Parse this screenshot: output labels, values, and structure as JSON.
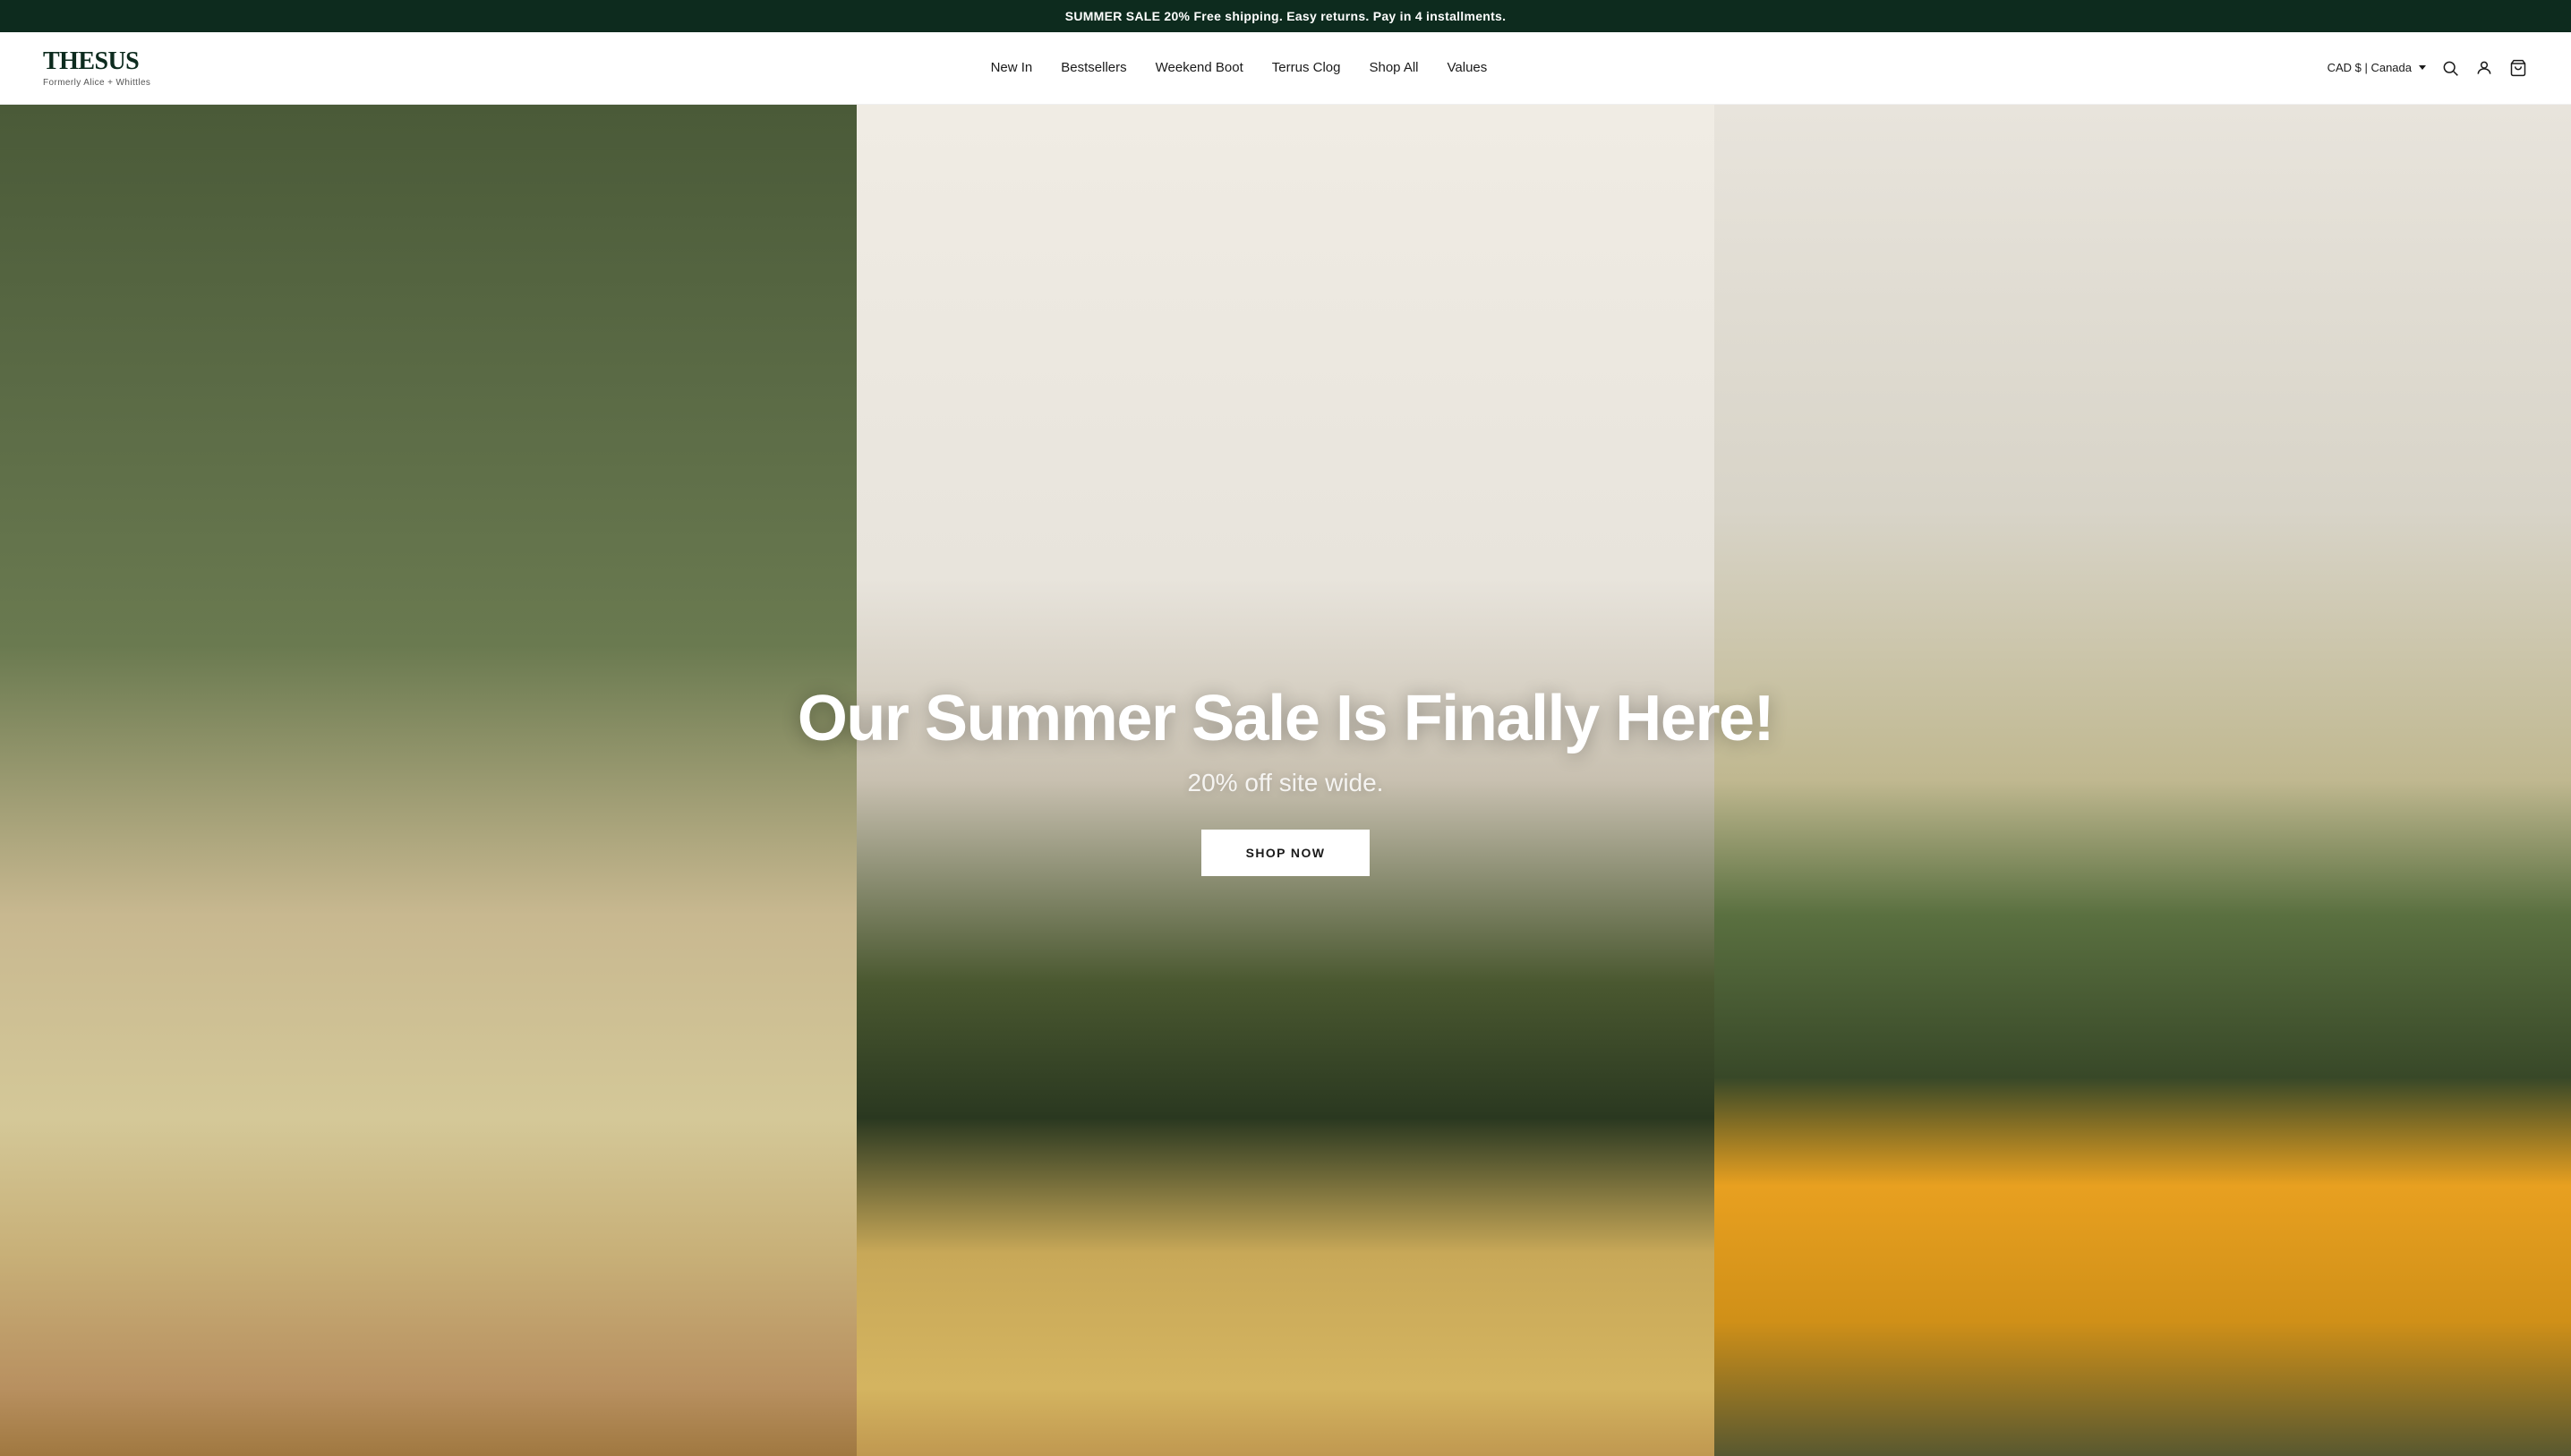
{
  "announcement": {
    "text": "SUMMER SALE 20% Free shipping. Easy returns. Pay in 4 installments."
  },
  "header": {
    "logo": {
      "name": "THESUS",
      "subtitle": "Formerly Alice + Whittles"
    },
    "nav": [
      {
        "label": "New In",
        "id": "new-in"
      },
      {
        "label": "Bestsellers",
        "id": "bestsellers"
      },
      {
        "label": "Weekend Boot",
        "id": "weekend-boot"
      },
      {
        "label": "Terrus Clog",
        "id": "terrus-clog"
      },
      {
        "label": "Shop All",
        "id": "shop-all"
      },
      {
        "label": "Values",
        "id": "values"
      }
    ],
    "currency": {
      "label": "CAD $ | Canada"
    },
    "actions": {
      "search": "Search",
      "account": "Log in",
      "cart": "Cart"
    }
  },
  "hero": {
    "title": "Our Summer Sale Is Finally Here!",
    "subtitle": "20% off site wide.",
    "cta_label": "SHOP NOW"
  }
}
